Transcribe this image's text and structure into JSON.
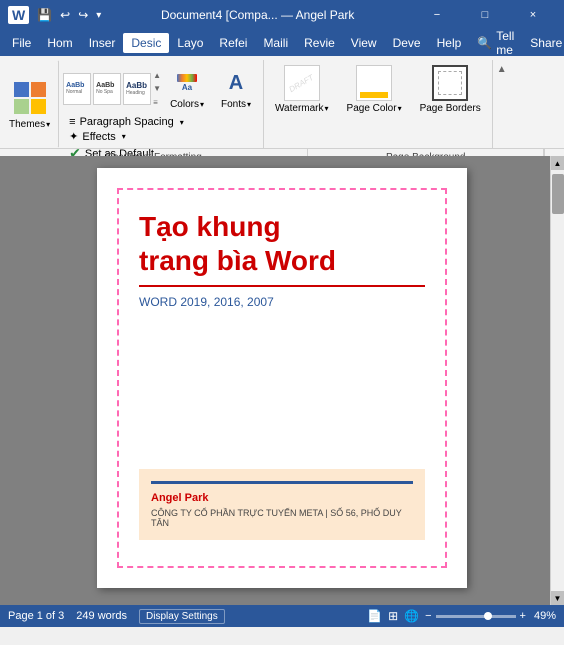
{
  "titlebar": {
    "title": "Document4 [Compa... — Angel Park",
    "save_icon": "💾",
    "undo_icon": "↩",
    "redo_icon": "↪",
    "customize_icon": "▾",
    "minimize": "−",
    "maximize": "□",
    "close": "×"
  },
  "menubar": {
    "items": [
      "File",
      "Hom",
      "Inser",
      "Desic",
      "Layo",
      "Refei",
      "Maili",
      "Revie",
      "View",
      "Deve",
      "Help"
    ],
    "active": "Desic",
    "tell_me": "Tell me",
    "share": "Share"
  },
  "ribbon": {
    "themes_label": "Themes",
    "colors_label": "Colors",
    "fonts_label": "Fonts",
    "paragraph_spacing_label": "Paragraph Spacing",
    "effects_label": "Effects",
    "set_default_label": "Set as Default",
    "doc_formatting_label": "Document Formatting",
    "watermark_label": "Watermark",
    "page_color_label": "Page Color",
    "page_borders_label": "Page Borders",
    "page_background_label": "Page Background",
    "style_sets": [
      "AaBb",
      "AaBb",
      "AaBb"
    ],
    "dropdown_arrow": "▾",
    "checkmark": "✔",
    "collapse_icon": "▲"
  },
  "document": {
    "title_line1": "Tạo khung",
    "title_line2": "trang bìa Word",
    "subtitle": "WORD 2019, 2016, 2007",
    "footer_name": "Angel Park",
    "footer_company": "CÔNG TY CỔ PHẦN TRỰC TUYẾN META | SỐ 56, PHỐ DUY TÂN"
  },
  "statusbar": {
    "page_info": "Page 1 of 3",
    "word_count": "249 words",
    "display_settings": "Display Settings",
    "zoom_percent": "49%",
    "zoom_minus": "−",
    "zoom_plus": "+"
  }
}
